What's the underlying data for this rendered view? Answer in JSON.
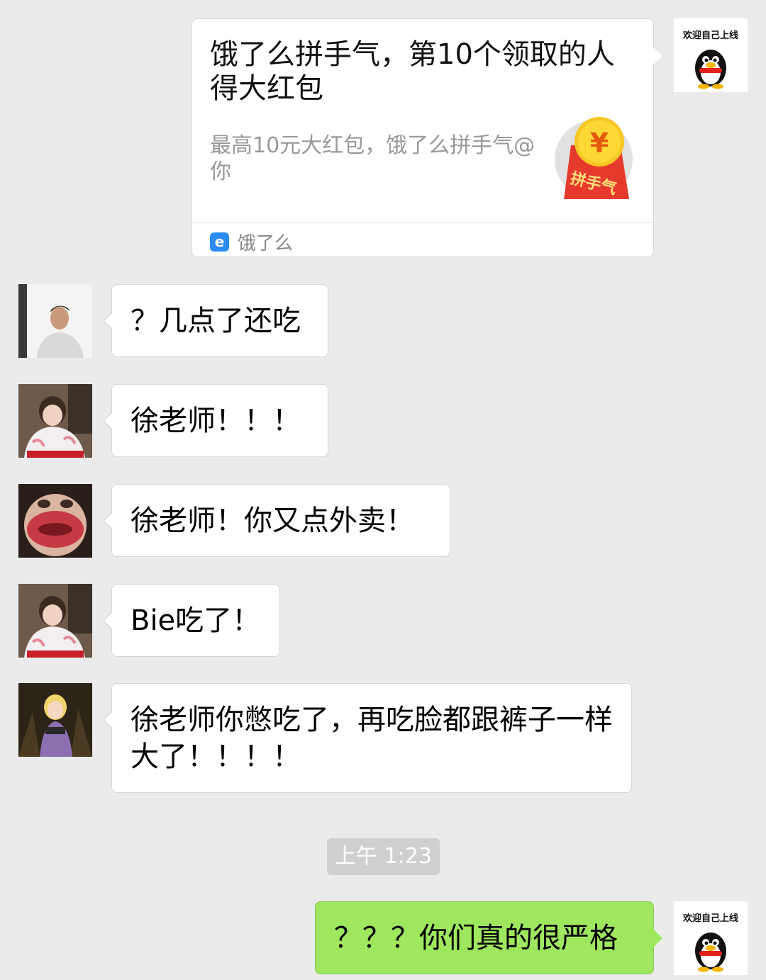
{
  "card": {
    "title": "饿了么拼手气，第10个领取的人得大红包",
    "desc": "最高10元大红包，饿了么拼手气@你",
    "source": "饿了么",
    "packet_label": "拼手气",
    "packet_symbol": "¥"
  },
  "self_avatar_text": "欢迎自己上线",
  "messages": [
    {
      "text": "？几点了还吃"
    },
    {
      "text": "徐老师！！！"
    },
    {
      "text": "徐老师！你又点外卖！"
    },
    {
      "text": "Bie吃了！"
    },
    {
      "text": "徐老师你憋吃了，再吃脸都跟裤子一样大了！！！！"
    }
  ],
  "timestamp": "上午 1:23",
  "outgoing": {
    "text": "？？？你们真的很严格"
  }
}
